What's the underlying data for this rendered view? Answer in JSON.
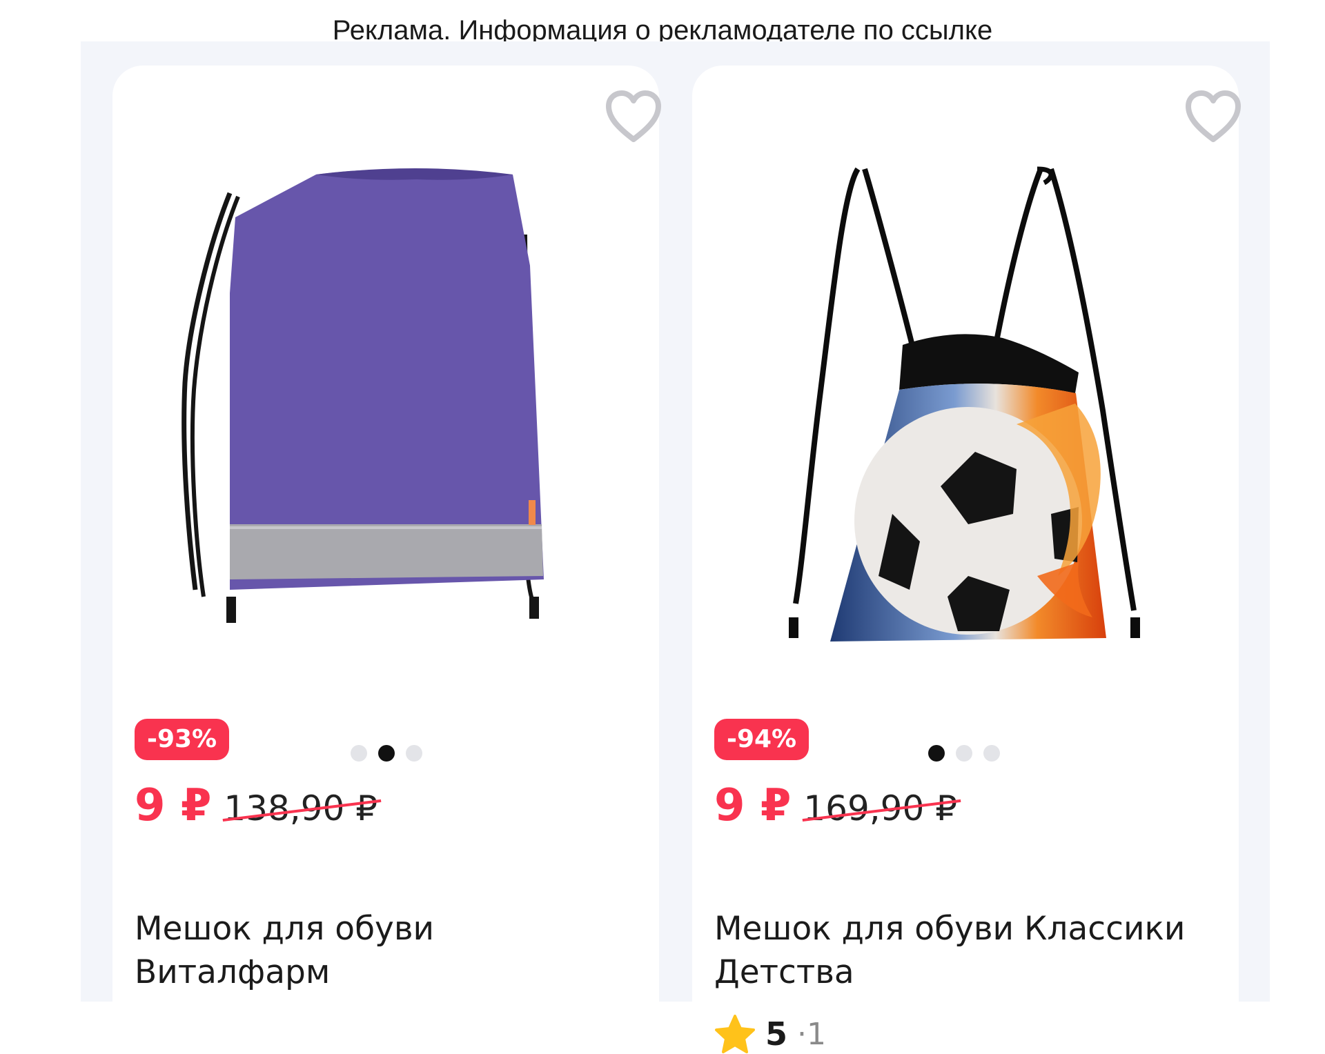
{
  "ad_banner": "Реклама. Информация о рекламодателе по ссылке",
  "products": [
    {
      "discount": "-93%",
      "price": "9 ₽",
      "old_price": "138,90 ₽",
      "title": "Мешок для обуви Виталфарм",
      "image_dots": {
        "count": 3,
        "active_index": 1
      },
      "favorite_icon": "heart-outline-icon",
      "image_description_icon": "purple-drawstring-bag"
    },
    {
      "discount": "-94%",
      "price": "9 ₽",
      "old_price": "169,90 ₽",
      "title": "Мешок для обуви Классики Детства",
      "image_dots": {
        "count": 3,
        "active_index": 0
      },
      "favorite_icon": "heart-outline-icon",
      "image_description_icon": "soccer-ball-drawstring-bag",
      "rating": {
        "score": "5",
        "count": "·1",
        "icon": "star-icon"
      }
    }
  ],
  "colors": {
    "accent": "#f9334f",
    "feed_background": "#f3f5fa",
    "card": "#ffffff",
    "dot_active": "#111111",
    "dot_inactive": "#e3e4e8",
    "star": "#ffc21a"
  }
}
